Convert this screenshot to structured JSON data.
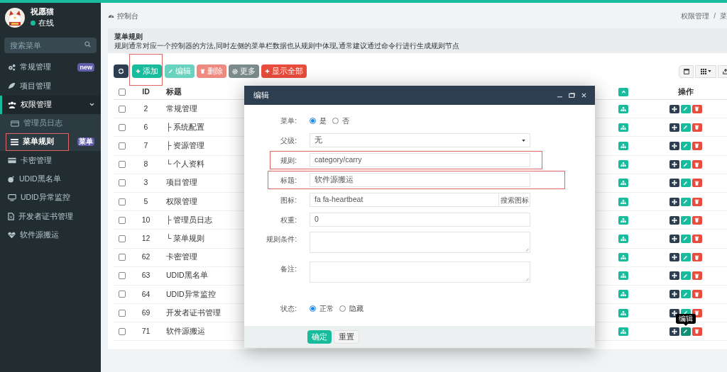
{
  "sidebar": {
    "user": {
      "name": "祝愿猫",
      "status": "在线"
    },
    "search": {
      "placeholder": "搜索菜单"
    },
    "items": [
      {
        "label": "常规管理",
        "badge": "new",
        "selected": false
      },
      {
        "label": "项目管理",
        "selected": false
      },
      {
        "label": "权限管理",
        "selected": false,
        "expanded": true,
        "children": [
          {
            "label": "管理员日志",
            "selected": false
          },
          {
            "label": "菜单规则",
            "badge": "菜单",
            "selected": true,
            "annotated": true
          }
        ]
      },
      {
        "label": "卡密管理",
        "selected": false
      },
      {
        "label": "UDID黑名单",
        "selected": false
      },
      {
        "label": "UDID异常监控",
        "selected": false
      },
      {
        "label": "开发者证书管理",
        "selected": false
      },
      {
        "label": "软件源搬运",
        "selected": false
      }
    ]
  },
  "breadcrumb": {
    "home": "控制台",
    "trail": [
      "权限管理",
      "菜"
    ],
    "separator": "/"
  },
  "panel": {
    "title": "菜单规则",
    "description": "规则通常对应一个控制器的方法,同时左侧的菜单栏数据也从规则中体现,通常建议通过命令行进行生成规则节点"
  },
  "toolbar": {
    "buttons": [
      {
        "kind": "refresh",
        "disabled": false
      },
      {
        "kind": "add",
        "label": "添加",
        "disabled": false,
        "annotated": true
      },
      {
        "kind": "edit",
        "label": "编辑",
        "disabled": true
      },
      {
        "kind": "delete",
        "label": "删除",
        "disabled": true
      },
      {
        "kind": "more",
        "label": "更多",
        "disabled": false
      },
      {
        "kind": "show-all",
        "label": "显示全部",
        "disabled": false
      }
    ]
  },
  "table": {
    "header_checked": false,
    "columns": [
      {
        "label": "ID"
      },
      {
        "label": "标题"
      },
      {
        "label": "操作"
      }
    ],
    "rows": [
      {
        "id": "2",
        "title": "常规管理",
        "checked": false
      },
      {
        "id": "6",
        "title": "├ 系统配置",
        "checked": false
      },
      {
        "id": "7",
        "title": "├ 资源管理",
        "checked": false
      },
      {
        "id": "8",
        "title": "└ 个人资料",
        "checked": false
      },
      {
        "id": "3",
        "title": "项目管理",
        "checked": false
      },
      {
        "id": "5",
        "title": "权限管理",
        "checked": false
      },
      {
        "id": "10",
        "title": "├ 管理员日志",
        "checked": false
      },
      {
        "id": "12",
        "title": "└ 菜单规则",
        "checked": false
      },
      {
        "id": "62",
        "title": "卡密管理",
        "checked": false
      },
      {
        "id": "63",
        "title": "UDID黑名单",
        "checked": false
      },
      {
        "id": "64",
        "title": "UDID异常监控",
        "checked": false
      },
      {
        "id": "69",
        "title": "开发者证书管理",
        "checked": false
      },
      {
        "id": "71",
        "title": "软件源搬运",
        "checked": false,
        "tooltip": "编辑"
      }
    ]
  },
  "modal": {
    "title": "编辑",
    "fields": [
      {
        "kind": "radio",
        "label": "菜单:",
        "options": [
          {
            "label": "是",
            "selected": true
          },
          {
            "label": "否",
            "selected": false
          }
        ]
      },
      {
        "kind": "select",
        "label": "父级:",
        "value": "无"
      },
      {
        "kind": "text",
        "label": "规则:",
        "value": "category/carry",
        "annotated": true
      },
      {
        "kind": "text",
        "label": "标题:",
        "value": "软件源搬运",
        "annotated": true
      },
      {
        "kind": "text-button",
        "label": "图标:",
        "value": "fa fa-heartbeat",
        "button": "搜索图标"
      },
      {
        "kind": "text",
        "label": "权重:",
        "value": "0"
      },
      {
        "kind": "textarea",
        "label": "规则条件:"
      },
      {
        "kind": "textarea",
        "label": "备注:"
      },
      {
        "kind": "radio",
        "label": "状态:",
        "options": [
          {
            "label": "正常",
            "selected": true
          },
          {
            "label": "隐藏",
            "selected": false
          }
        ]
      }
    ],
    "buttons": [
      {
        "kind": "primary",
        "label": "确定"
      },
      {
        "kind": "default",
        "label": "重置"
      }
    ]
  }
}
